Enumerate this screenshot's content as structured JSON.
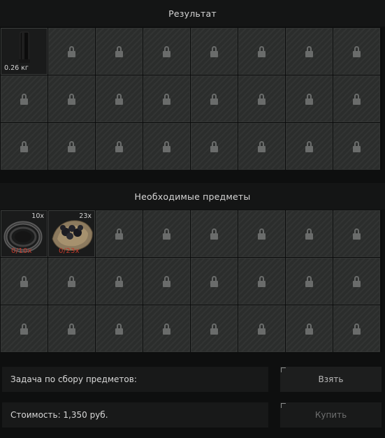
{
  "result_section": {
    "title": "Результат",
    "item": {
      "name": "black-cylinder-item",
      "weight": "0.26 кг"
    },
    "locked_slots": 23
  },
  "required_section": {
    "title": "Необходимые предметы",
    "items": [
      {
        "name": "wire-coil-item",
        "count": "10x",
        "progress": "0/10x"
      },
      {
        "name": "stones-pile-item",
        "count": "23x",
        "progress": "0/23x"
      }
    ],
    "locked_slots": 22
  },
  "task": {
    "label": "Задача по сбору предметов:"
  },
  "cost": {
    "label": "Стоимость: 1,350 руб."
  },
  "buttons": {
    "take": "Взять",
    "buy": "Купить"
  },
  "colors": {
    "background": "#0e0f0f",
    "slot": "#2b2d2c",
    "lock": "#6a6c6b",
    "progress_text": "#c23a2b"
  }
}
